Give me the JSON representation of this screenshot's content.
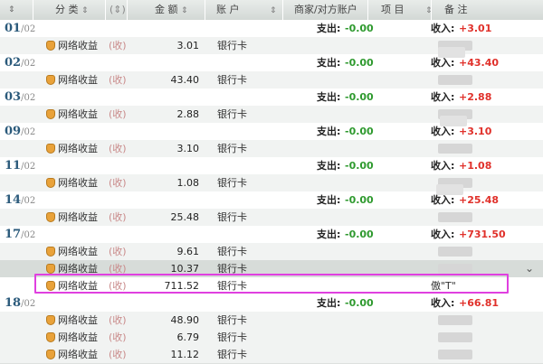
{
  "header": {
    "columns": [
      {
        "label": "分 类",
        "arrow": "⇕"
      },
      {
        "label": "(⇕)",
        "arrow": ""
      },
      {
        "label": "金 额",
        "arrow": "⇕"
      },
      {
        "label": "账 户",
        "arrow": "⇕"
      },
      {
        "label": "商家/对方账户",
        "arrow": ""
      },
      {
        "label": "项 目",
        "arrow": "⇕"
      },
      {
        "label": "备 注",
        "arrow": ""
      }
    ],
    "sort_glyph": "⇕",
    "scroll_glyph": "⌄"
  },
  "labels": {
    "expense": "支出:",
    "income": "收入:",
    "category": "网络收益",
    "type": "(收)",
    "account": "银行卡"
  },
  "groups": [
    {
      "day": "01",
      "month": "/02",
      "expense": "-0.00",
      "income": "+3.01",
      "rows": [
        {
          "amount": "3.01"
        }
      ]
    },
    {
      "day": "02",
      "month": "/02",
      "expense": "-0.00",
      "income": "+43.40",
      "rows": [
        {
          "amount": "43.40"
        }
      ]
    },
    {
      "day": "03",
      "month": "/02",
      "expense": "-0.00",
      "income": "+2.88",
      "rows": [
        {
          "amount": "2.88"
        }
      ]
    },
    {
      "day": "09",
      "month": "/02",
      "expense": "-0.00",
      "income": "+3.10",
      "rows": [
        {
          "amount": "3.10"
        }
      ]
    },
    {
      "day": "11",
      "month": "/02",
      "expense": "-0.00",
      "income": "+1.08",
      "rows": [
        {
          "amount": "1.08"
        }
      ]
    },
    {
      "day": "14",
      "month": "/02",
      "expense": "-0.00",
      "income": "+25.48",
      "rows": [
        {
          "amount": "25.48"
        }
      ]
    },
    {
      "day": "17",
      "month": "/02",
      "expense": "-0.00",
      "income": "+731.50",
      "rows": [
        {
          "amount": "9.61"
        },
        {
          "amount": "10.37"
        },
        {
          "amount": "711.52",
          "note": "傲\"T\""
        }
      ]
    },
    {
      "day": "18",
      "month": "/02",
      "expense": "-0.00",
      "income": "+66.81",
      "rows": [
        {
          "amount": "48.90"
        },
        {
          "amount": "6.79"
        },
        {
          "amount": "11.12"
        }
      ]
    }
  ],
  "colors": {
    "income": "#e0302a",
    "expense": "#2f9a2f",
    "highlight": "#e040e0",
    "date": "#2b5a7b"
  }
}
